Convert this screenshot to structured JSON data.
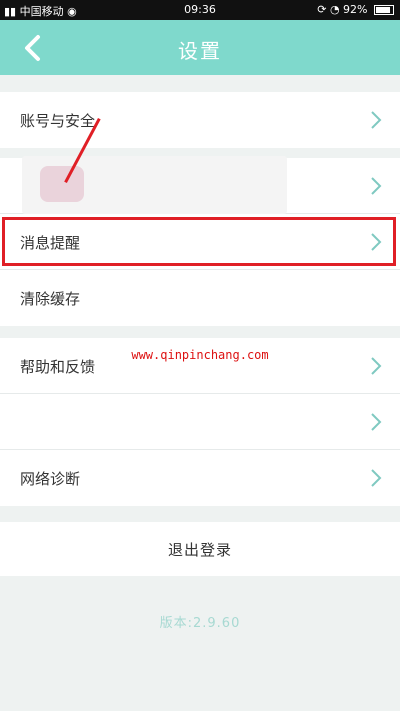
{
  "status_bar": {
    "carrier": "中国移动",
    "time": "09:36",
    "battery": "92%"
  },
  "header": {
    "title": "设置"
  },
  "menu": {
    "items": [
      {
        "label": "账号与安全"
      },
      {
        "label": ""
      },
      {
        "label": "消息提醒"
      },
      {
        "label": "清除缓存"
      },
      {
        "label": "帮助和反馈"
      },
      {
        "label": ""
      },
      {
        "label": "网络诊断"
      }
    ]
  },
  "logout": {
    "label": "退出登录"
  },
  "footer": {
    "version": "版本:2.9.60"
  },
  "watermark": {
    "text": "www.qinpinchang.com"
  },
  "colors": {
    "header_bg": "#7fd9cc",
    "highlight": "#e01f26",
    "chevron": "#7fc9c1"
  }
}
